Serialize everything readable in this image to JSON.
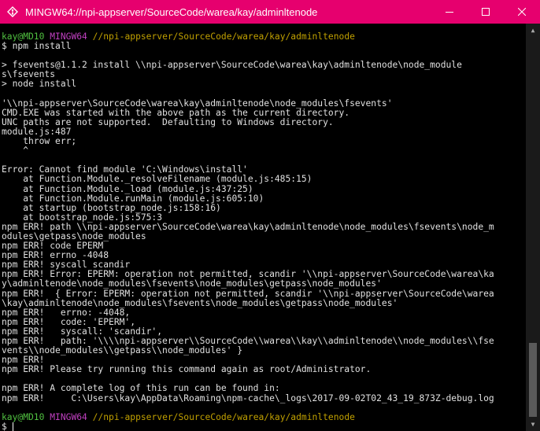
{
  "window": {
    "title": "MINGW64://npi-appserver/SourceCode/warea/kay/adminltenode",
    "icon": "git-bash-icon",
    "controls": {
      "minimize": "—",
      "maximize": "☐",
      "close": "✕"
    }
  },
  "prompt1": {
    "user": "kay@MD10",
    "shell": "MINGW64",
    "path": "//npi-appserver/SourceCode/warea/kay/adminltenode",
    "command": "$ npm install"
  },
  "output": [
    "",
    "> fsevents@1.1.2 install \\\\npi-appserver\\SourceCode\\warea\\kay\\adminltenode\\node_module",
    "s\\fsevents",
    "> node install",
    "",
    "'\\\\npi-appserver\\SourceCode\\warea\\kay\\adminltenode\\node_modules\\fsevents'",
    "CMD.EXE was started with the above path as the current directory.",
    "UNC paths are not supported.  Defaulting to Windows directory.",
    "module.js:487",
    "    throw err;",
    "    ^",
    "",
    "Error: Cannot find module 'C:\\Windows\\install'",
    "    at Function.Module._resolveFilename (module.js:485:15)",
    "    at Function.Module._load (module.js:437:25)",
    "    at Function.Module.runMain (module.js:605:10)",
    "    at startup (bootstrap_node.js:158:16)",
    "    at bootstrap_node.js:575:3",
    "npm ERR! path \\\\npi-appserver\\SourceCode\\warea\\kay\\adminltenode\\node_modules\\fsevents\\node_m",
    "odules\\getpass\\node_modules",
    "npm ERR! code EPERM",
    "npm ERR! errno -4048",
    "npm ERR! syscall scandir",
    "npm ERR! Error: EPERM: operation not permitted, scandir '\\\\npi-appserver\\SourceCode\\warea\\ka",
    "y\\adminltenode\\node_modules\\fsevents\\node_modules\\getpass\\node_modules'",
    "npm ERR!  { Error: EPERM: operation not permitted, scandir '\\\\npi-appserver\\SourceCode\\warea",
    "\\kay\\adminltenode\\node_modules\\fsevents\\node_modules\\getpass\\node_modules'",
    "npm ERR!   errno: -4048,",
    "npm ERR!   code: 'EPERM',",
    "npm ERR!   syscall: 'scandir',",
    "npm ERR!   path: '\\\\\\\\npi-appserver\\\\SourceCode\\\\warea\\\\kay\\\\adminltenode\\\\node_modules\\\\fse",
    "vents\\\\node_modules\\\\getpass\\\\node_modules' }",
    "npm ERR!",
    "npm ERR! Please try running this command again as root/Administrator.",
    "",
    "npm ERR! A complete log of this run can be found in:",
    "npm ERR!     C:\\Users\\kay\\AppData\\Roaming\\npm-cache\\_logs\\2017-09-02T02_43_19_873Z-debug.log",
    ""
  ],
  "prompt2": {
    "user": "kay@MD10",
    "shell": "MINGW64",
    "path": "//npi-appserver/SourceCode/warea/kay/adminltenode",
    "command": "$ "
  },
  "colors": {
    "titlebar": "#e6006e",
    "user": "#50c040",
    "shell": "#c040c0",
    "path": "#c0a000"
  }
}
